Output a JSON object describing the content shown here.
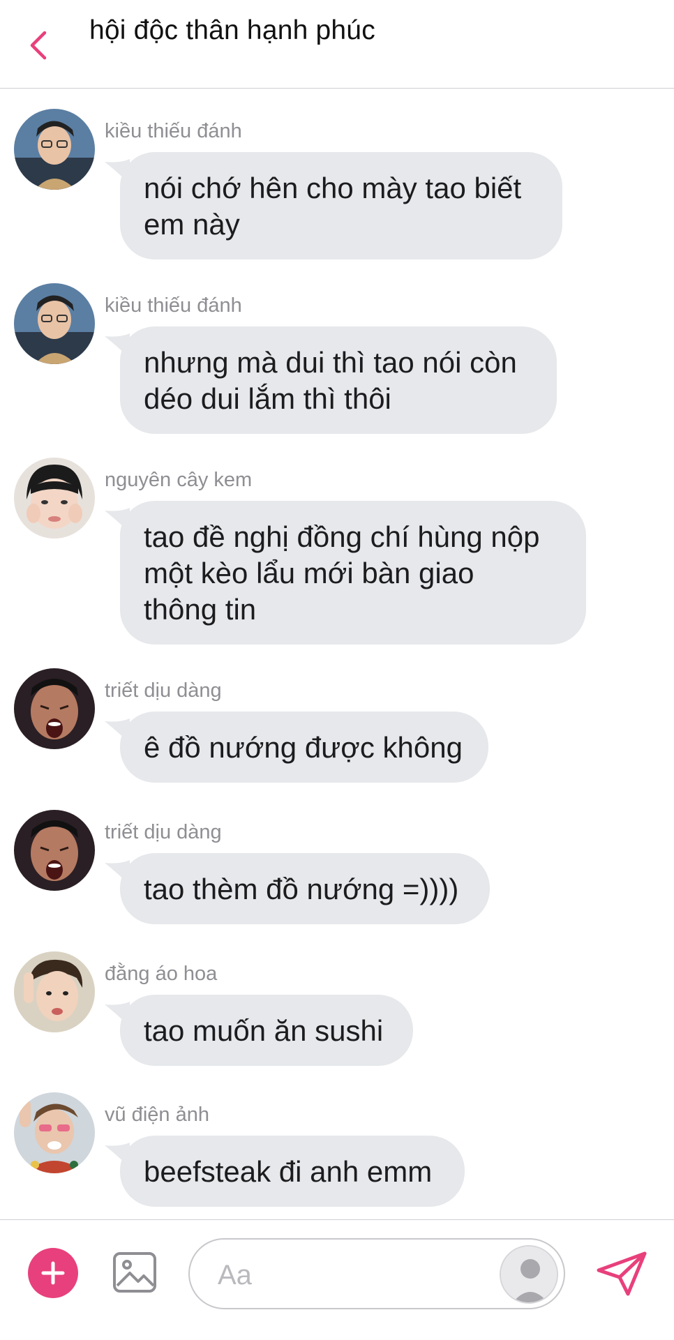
{
  "header": {
    "title": "hội độc thân hạnh phúc",
    "accent_color": "#e8407c",
    "back_icon": "chevron-left-icon"
  },
  "messages": [
    {
      "sender": "kiều thiếu đánh",
      "lines": [
        "nói chớ hên cho mày tao biết",
        "em này"
      ]
    },
    {
      "sender": "kiều thiếu đánh",
      "lines": [
        "nhưng mà dui thì tao nói còn",
        "déo dui lắm thì thôi"
      ]
    },
    {
      "sender": "nguyên cây kem",
      "lines": [
        "tao đề nghị đồng chí hùng nộp",
        "một kèo lẩu mới bàn giao",
        "thông tin"
      ]
    },
    {
      "sender": "triết dịu dàng",
      "lines": [
        "ê đồ nướng được không"
      ]
    },
    {
      "sender": "triết dịu dàng",
      "lines": [
        "tao thèm đồ nướng =))))"
      ]
    },
    {
      "sender": "đằng áo hoa",
      "lines": [
        "tao muốn ăn sushi"
      ]
    },
    {
      "sender": "vũ điện ảnh",
      "lines": [
        "beefsteak đi anh emm"
      ]
    }
  ],
  "composer": {
    "placeholder": "Aa",
    "value": "",
    "plus_icon": "plus-icon",
    "image_icon": "image-icon",
    "send_icon": "send-icon"
  },
  "colors": {
    "bubble": "#e6e8eb",
    "sender_text": "#8e8e93",
    "accent": "#e8407c"
  }
}
